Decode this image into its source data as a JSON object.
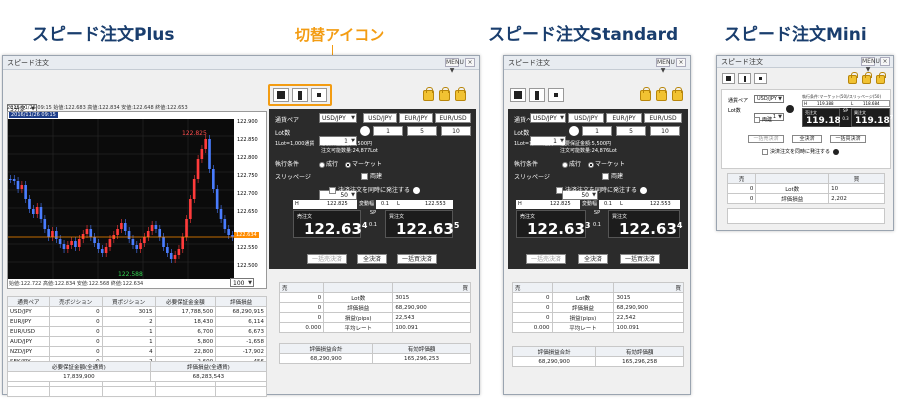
{
  "headings": {
    "plus": "スピード注文Plus",
    "switch": "切替アイコン",
    "standard": "スピード注文Standard",
    "mini": "スピード注文Mini"
  },
  "window": {
    "title": "スピード注文",
    "menu_btn": "MENU ▼",
    "close": "×"
  },
  "plus": {
    "interval": "5分足",
    "chart_type": "ローソク(BID)",
    "ohlc_line": "2016/11/26 09:15  始値:122.683  高値:122.834  安値:122.648  終値:122.653",
    "ohlc_line2": "2016/11/26 09:15",
    "y_ticks": [
      "122.900",
      "122.850",
      "122.800",
      "122.750",
      "122.700",
      "122.650",
      "122.600",
      "122.550",
      "122.500"
    ],
    "current_price": "122.634",
    "high_label": "122.825",
    "low_label": "122.588",
    "x_ticks": "始値:122.722  高値:122.834  安値:122.568  終値:122.634",
    "zoom": "100",
    "positions": {
      "headers": [
        "通貨ペア",
        "売ポジション",
        "買ポジション",
        "必要保証金金額",
        "評価損益"
      ],
      "rows": [
        [
          "USD/JPY",
          "0",
          "3015",
          "17,788,500",
          "68,290,915"
        ],
        [
          "EUR/JPY",
          "0",
          "2",
          "18,430",
          "6,114"
        ],
        [
          "EUR/USD",
          "0",
          "1",
          "6,700",
          "6,673"
        ],
        [
          "AUD/JPY",
          "0",
          "1",
          "5,800",
          "-1,658"
        ],
        [
          "NZD/JPY",
          "0",
          "4",
          "22,800",
          "-17,902"
        ],
        [
          "SEK/JPY",
          "0",
          "2",
          "2,600",
          "456"
        ]
      ]
    },
    "bottom": {
      "h1": "必要保証金額(全通貨)",
      "h2": "評価損益(全通貨)",
      "v1": "17,839,900",
      "v2": "68,283,543"
    }
  },
  "order": {
    "pair_label": "通貨ペア",
    "pair": "USD/JPY",
    "pair_btns": [
      "USD/JPY",
      "EUR/JPY",
      "EUR/USD"
    ],
    "pair_btn_last": "EUR/USD",
    "lot_label": "Lot数",
    "lot": "1",
    "lot_btns": [
      "1",
      "5",
      "10"
    ],
    "lot_note": "1Lot=1,000通貨",
    "margin_note": "必要保証金額:5,500円",
    "order_possible": "注文可能数量:24,877Lot",
    "order_possible_std": "注文可能数量:24,876Lot",
    "exec_label": "執行条件",
    "exec_opt1": "成行",
    "exec_opt2": "マーケット",
    "slip_label": "スリッページ",
    "slip": "50",
    "both": "両建",
    "settle_label": "決済注文を同時に発注する",
    "h_label": "H",
    "h_val": "122.825",
    "spread_lbl": "変動幅",
    "spread_val": "0.1",
    "l_label": "L",
    "l_val": "122.553",
    "sell_label": "売注文",
    "buy_label": "買注文",
    "sp_label": "SP",
    "sp_val": "0.1",
    "sell_main": "122.63",
    "sell_sup": "4",
    "buy_main": "122.63",
    "buy_sup": "5",
    "std_sell_main": "122.63",
    "std_sell_sup": "3",
    "std_buy_main": "122.63",
    "std_buy_sup": "4",
    "btn_close_batch": "一括売決済",
    "btn_all": "全決済",
    "btn_batch_buy": "一括買決済",
    "summary": {
      "sell": "売",
      "buy": "買",
      "rows": [
        [
          "0",
          "Lot数",
          "3015"
        ],
        [
          "0",
          "評価損益",
          "68,290,900"
        ],
        [
          "0",
          "損益(pips)",
          "22,543"
        ],
        [
          "0.000",
          "平均レート",
          "100.091"
        ]
      ]
    },
    "totals": {
      "h1": "評価損益合計",
      "h2": "有効評価額",
      "v1": "68,290,900",
      "v2": "165,296,253"
    },
    "totals_std": {
      "v1": "68,290,900",
      "v2": "165,296,258"
    }
  },
  "std_summary_rows": [
    [
      "0",
      "Lot数",
      "3015"
    ],
    [
      "0",
      "評価損益",
      "68,290,900"
    ],
    [
      "0",
      "損益(pips)",
      "22,542"
    ],
    [
      "0.000",
      "平均レート",
      "100.091"
    ]
  ],
  "mini": {
    "pair_label": "通貨ペア",
    "pair": "USD/JPY",
    "lot_label": "Lot数",
    "lot": "1",
    "info": "執行条件:マーケット(50)/スリッページ(50)",
    "h": "H",
    "h_val": "119.388",
    "l": "L",
    "l_val": "118.684",
    "sell": "売注文",
    "buy": "買注文",
    "sp": "SP",
    "sp_val": "0.3",
    "sell_main": "119.18",
    "sell_sup": "4",
    "buy_main": "119.18",
    "buy_sup": "7",
    "both": "両建",
    "btn1": "一括売決済",
    "btn2": "全決済",
    "btn3": "一括買決済",
    "settle": "決済注文を同時に発注する",
    "sum_sell": "売",
    "sum_buy": "買",
    "rows": [
      [
        "0",
        "Lot数",
        "10"
      ],
      [
        "0",
        "評価損益",
        "2,202"
      ]
    ]
  },
  "colors": {
    "orange": "#f39c12",
    "heading": "#1a3e6e",
    "lock": "#f1c232"
  }
}
